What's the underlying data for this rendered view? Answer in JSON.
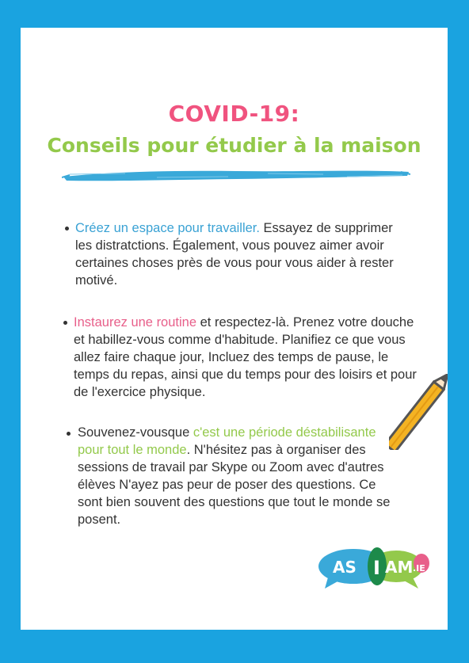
{
  "header": {
    "title": "COVID-19:",
    "subtitle": "Conseils pour étudier à la maison"
  },
  "tips": [
    {
      "highlight": "Créez un espace pour travailler.",
      "text": " Essayez de supprimer les distratctions. Également, vous pouvez aimer avoir certaines choses près de vous pour vous aider à rester motivé."
    },
    {
      "highlight": "Instaurez une routine",
      "text": " et respectez-là. Prenez votre douche et habillez-vous comme d'habitude. Planifiez ce que vous allez faire chaque jour, Incluez des temps de pause, le temps du repas, ainsi que du temps pour des loisirs et pour de l'exercice physique."
    },
    {
      "prefix": "Souvenez-vousque ",
      "highlight": "c'est une période déstabilisante pour tout le monde",
      "text": ". N'hésitez pas à organiser des sessions de travail par Skype ou Zoom avec d'autres élèves  N'ayez pas peur de poser des questions. Ce sont bien souvent des questions que tout le monde se posent."
    }
  ],
  "logo": {
    "part1": "AS",
    "part2": "I",
    "part3": "AM",
    "part4": ".IE"
  },
  "colors": {
    "background": "#1aa3e0",
    "title_pink": "#f0537f",
    "subtitle_green": "#93c94b",
    "highlight_blue": "#3aa2d4",
    "highlight_pink": "#e85f8a",
    "highlight_green": "#93c94b"
  },
  "icons": [
    "brush-stroke",
    "pencil-icon",
    "asiam-logo"
  ]
}
